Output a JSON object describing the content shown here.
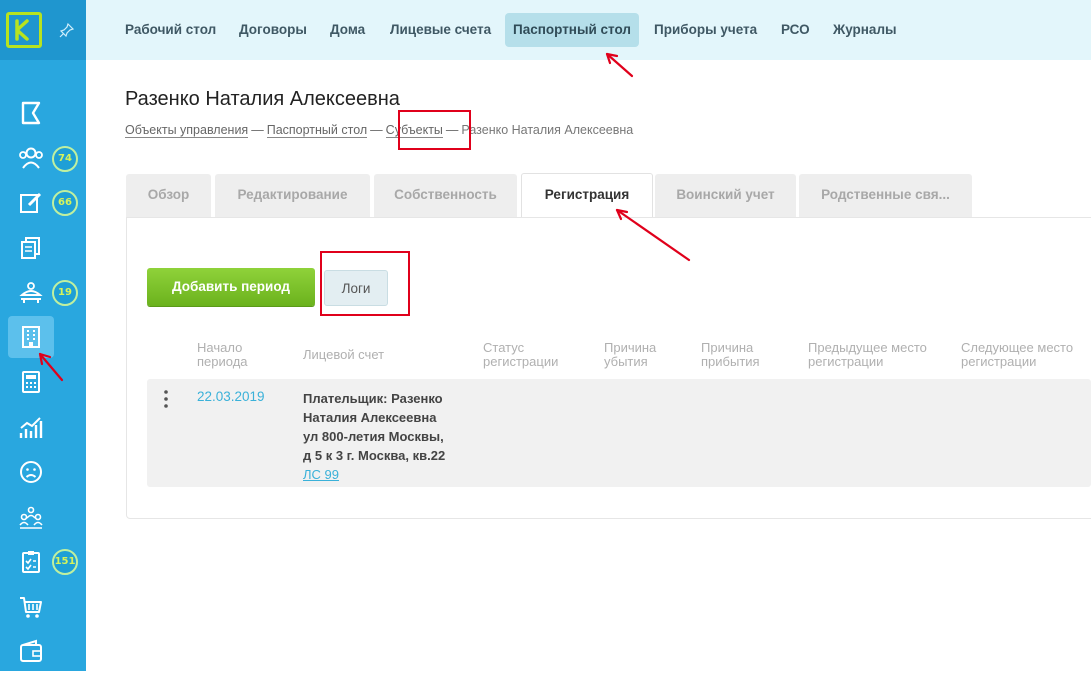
{
  "sidebar": {
    "logo_letter": "K",
    "pin_icon": "pin-icon",
    "items": [
      {
        "icon": "flag-icon",
        "badge": ""
      },
      {
        "icon": "users-icon",
        "badge": "74"
      },
      {
        "icon": "edit-icon",
        "badge": "66"
      },
      {
        "icon": "documents-icon",
        "badge": ""
      },
      {
        "icon": "service-icon",
        "badge": "19"
      },
      {
        "icon": "building-icon",
        "badge": ""
      },
      {
        "icon": "calculator-icon",
        "badge": ""
      },
      {
        "icon": "chart-icon",
        "badge": ""
      },
      {
        "icon": "sad-face-icon",
        "badge": ""
      },
      {
        "icon": "group-icon",
        "badge": ""
      },
      {
        "icon": "checklist-icon",
        "badge": "151"
      },
      {
        "icon": "cart-icon",
        "badge": ""
      },
      {
        "icon": "wallet-icon",
        "badge": ""
      }
    ]
  },
  "topnav": {
    "items": [
      "Рабочий стол",
      "Договоры",
      "Дома",
      "Лицевые счета",
      "Паспортный стол",
      "Приборы учета",
      "РСО",
      "Журналы"
    ],
    "active": "Паспортный стол"
  },
  "page": {
    "title": "Разенко Наталия Алексеевна",
    "breadcrumb": [
      "Объекты управления",
      "Паспортный стол",
      "Субъекты",
      "Разенко Наталия Алексеевна"
    ],
    "breadcrumb_sep": "—"
  },
  "tabs": {
    "items": [
      "Обзор",
      "Редактирование",
      "Собственность",
      "Регистрация",
      "Воинский учет",
      "Родственные свя..."
    ],
    "active": "Регистрация"
  },
  "actions": {
    "add_period": "Добавить период",
    "logs": "Логи"
  },
  "table": {
    "headers": [
      [
        "Начало",
        "периода"
      ],
      [
        "Лицевой счет",
        ""
      ],
      [
        "Статус",
        "регистрации"
      ],
      [
        "Причина",
        "убытия"
      ],
      [
        "Причина",
        "прибытия"
      ],
      [
        "Предыдущее место",
        "регистрации"
      ],
      [
        "Следующее место",
        "регистрации"
      ]
    ],
    "rows": [
      {
        "start": "22.03.2019",
        "account_lines": [
          "Плательщик: Разенко",
          "Наталия Алексеевна",
          "ул 800-летия Москвы,",
          "д 5 к 3 г. Москва, кв.22"
        ],
        "account_link": "ЛС 99"
      }
    ]
  },
  "colors": {
    "sidebar": "#29a7df",
    "topbar": "#e3f6fb",
    "accent_green": "#7cc22a",
    "link": "#3ab1d9",
    "annotation": "#e0001b"
  }
}
